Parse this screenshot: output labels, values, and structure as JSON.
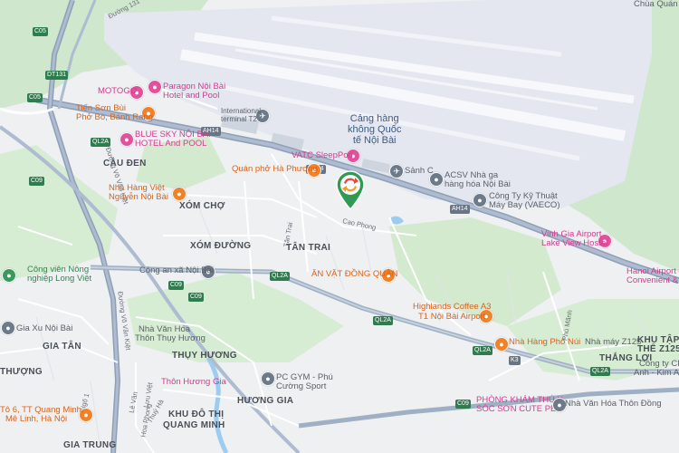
{
  "map": {
    "airport": {
      "name_line1": "Cảng hàng",
      "name_line2": "không Quốc",
      "name_line3": "tế Nội Bài"
    },
    "areas": [
      {
        "name": "CẦU ĐEN"
      },
      {
        "name": "XÓM CHỢ"
      },
      {
        "name": "XÓM ĐƯỜNG"
      },
      {
        "name": "TÂN TRAI"
      },
      {
        "name": "GIA TÂN"
      },
      {
        "name": "THƯỢNG"
      },
      {
        "name": "THỤY HƯƠNG"
      },
      {
        "name": "KHU ĐÔ THỊ"
      },
      {
        "name": "QUANG MINH"
      },
      {
        "name": "HƯƠNG GIA"
      },
      {
        "name": "GIA TRUNG"
      },
      {
        "name": "THẮNG LỢI"
      },
      {
        "name": "KHU TẬP"
      },
      {
        "name": "THỂ Z125"
      }
    ],
    "pois": [
      {
        "label": "MOTOGO",
        "kind": "pink"
      },
      {
        "label": "Paragon Nội Bài",
        "kind": "pink"
      },
      {
        "label": "Hotel and Pool",
        "kind": "pink"
      },
      {
        "label": "Tiến Sơn Bùi",
        "kind": "orange"
      },
      {
        "label": "Phở Bò, Bánh Rang",
        "kind": "orange"
      },
      {
        "label": "BLUE SKY NỘI BÀI",
        "kind": "pink"
      },
      {
        "label": "HOTEL And POOL",
        "kind": "pink"
      },
      {
        "label": "International",
        "kind": "gray"
      },
      {
        "label": "terminal T2",
        "kind": "gray"
      },
      {
        "label": "VATC SleepPod",
        "kind": "pink"
      },
      {
        "label": "Quán phở Hà Phương",
        "kind": "orange"
      },
      {
        "label": "Nhà Hàng Việt",
        "kind": "orange"
      },
      {
        "label": "Nguyễn Nội Bài",
        "kind": "orange"
      },
      {
        "label": "Sảnh C",
        "kind": "gray"
      },
      {
        "label": "ACSV Nhà ga",
        "kind": "gray"
      },
      {
        "label": "hàng hóa Nội Bài",
        "kind": "gray"
      },
      {
        "label": "Công Ty Kỹ Thuật",
        "kind": "gray"
      },
      {
        "label": "Máy Bay (VAECO)",
        "kind": "gray"
      },
      {
        "label": "Vinh Gia Airport",
        "kind": "pink"
      },
      {
        "label": "Lake View Hostel",
        "kind": "pink"
      },
      {
        "label": "Hanoi Airport Ho",
        "kind": "pink"
      },
      {
        "label": "Convenient & Fr",
        "kind": "pink"
      },
      {
        "label": "Công viên Nông",
        "kind": "green"
      },
      {
        "label": "nghiệp Long Việt",
        "kind": "green"
      },
      {
        "label": "Công an xã Nội Bài",
        "kind": "gray"
      },
      {
        "label": "ĂN VẶT ĐỒNG QUÂN",
        "kind": "orange"
      },
      {
        "label": "Highlands Coffee A3",
        "kind": "orange"
      },
      {
        "label": "T1 Nội Bài Airport",
        "kind": "orange"
      },
      {
        "label": "Gia Xu Nội Bài",
        "kind": "gray"
      },
      {
        "label": "Nhà Văn Hóa",
        "kind": "gray"
      },
      {
        "label": "Thôn Thụy Hương",
        "kind": "gray"
      },
      {
        "label": "Nhà Hàng Phố Núi",
        "kind": "orange"
      },
      {
        "label": "Nhà máy Z125",
        "kind": "gray"
      },
      {
        "label": "Công ty CP C",
        "kind": "gray"
      },
      {
        "label": "Anh - Kim Anh T",
        "kind": "gray"
      },
      {
        "label": "PC GYM - Phú",
        "kind": "gray"
      },
      {
        "label": "Cường Sport",
        "kind": "gray"
      },
      {
        "label": "Thôn Hương Gia",
        "kind": "pink"
      },
      {
        "label": "Tô 6, TT Quang Minh,",
        "kind": "orange"
      },
      {
        "label": "Mê Linh, Hà Nội",
        "kind": "orange"
      },
      {
        "label": "PHÒNG KHÁM THÚ Y",
        "kind": "pink"
      },
      {
        "label": "SÓC SƠN CUTE PET",
        "kind": "pink"
      },
      {
        "label": "Nhà Văn Hóa Thôn Đồng",
        "kind": "gray"
      },
      {
        "label": "Chùa Quán Tr",
        "kind": "gray"
      }
    ],
    "roads": [
      {
        "label": "Đường 131"
      },
      {
        "label": "Cao Phong"
      },
      {
        "label": "Tân Trai"
      },
      {
        "label": "Đường Võ Văn Kiệt"
      },
      {
        "label": "Đường Võ Văn Kiệt"
      },
      {
        "label": "Hoa Phong"
      },
      {
        "label": "Lưu Việt"
      },
      {
        "label": "Lê Văn"
      },
      {
        "label": "Thuý Hà"
      },
      {
        "label": "Ngõ 1"
      },
      {
        "label": "Phù Mãnh"
      }
    ],
    "shields": [
      {
        "label": "C05"
      },
      {
        "label": "DT131"
      },
      {
        "label": "C05"
      },
      {
        "label": "QL2A"
      },
      {
        "label": "C09"
      },
      {
        "label": "AH14"
      },
      {
        "label": "AH14"
      },
      {
        "label": "AH14"
      },
      {
        "label": "QL2A"
      },
      {
        "label": "C09"
      },
      {
        "label": "QL2A"
      },
      {
        "label": "QL2A"
      },
      {
        "label": "K3"
      },
      {
        "label": "QL2A"
      },
      {
        "label": "C09"
      },
      {
        "label": "C09"
      }
    ],
    "icons": {
      "main_pin": "location-pin-icon",
      "restaurant": "restaurant-icon",
      "hotel": "hotel-icon",
      "airport": "airport-icon",
      "park": "park-icon"
    },
    "colors": {
      "pin_green": "#2e9a52",
      "pin_swap_red": "#e8473b",
      "pin_swap_orange": "#f39a2b",
      "highway": "#8ea0b6",
      "main_road": "#ffffff",
      "green_land": "#cfe8cd",
      "airport_surface": "#e4e7f0",
      "water": "#9ccdf0"
    }
  }
}
